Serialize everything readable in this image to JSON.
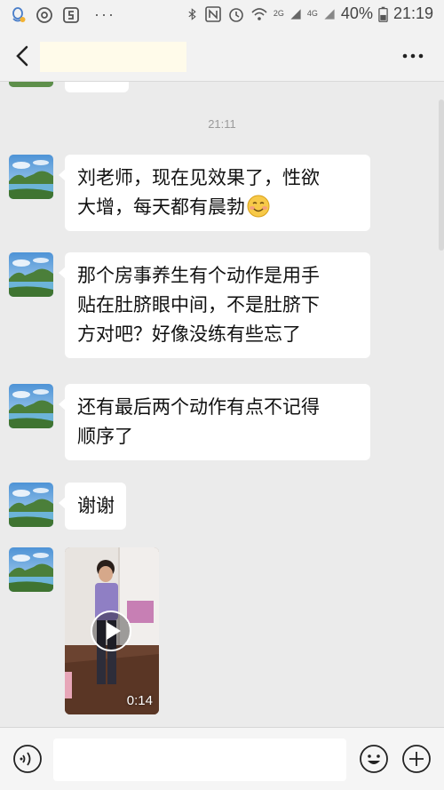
{
  "status_bar": {
    "battery_percent": "40%",
    "time": "21:19",
    "network_top": "2G",
    "network_bottom": "4G",
    "icons": [
      "qq-icon",
      "at-icon",
      "s-icon",
      "more-dots",
      "bluetooth-icon",
      "nfc-icon",
      "alarm-icon",
      "wifi-icon",
      "signal-icon",
      "battery-icon"
    ]
  },
  "header": {
    "title": "",
    "back_icon": "chevron-left-icon",
    "more_icon": "more-icon"
  },
  "chat": {
    "timestamp": "21:11",
    "messages": [
      {
        "type": "text",
        "lines": [
          "刘老师，现在见效果了，性欲",
          "大增，每天都有晨勃"
        ],
        "emoji": "smiling-face"
      },
      {
        "type": "text",
        "lines": [
          "那个房事养生有个动作是用手",
          "贴在肚脐眼中间，不是肚脐下",
          "方对吧？好像没练有些忘了"
        ]
      },
      {
        "type": "text",
        "lines": [
          "还有最后两个动作有点不记得",
          "顺序了"
        ]
      },
      {
        "type": "text",
        "lines": [
          "谢谢"
        ]
      },
      {
        "type": "video",
        "duration": "0:14"
      }
    ]
  },
  "input_bar": {
    "placeholder": "",
    "voice_icon": "voice-icon",
    "emoji_icon": "emoji-icon",
    "plus_icon": "plus-icon"
  },
  "colors": {
    "chat_background": "#ebebeb",
    "bubble": "#ffffff",
    "bar_background": "#f2f2f2"
  }
}
